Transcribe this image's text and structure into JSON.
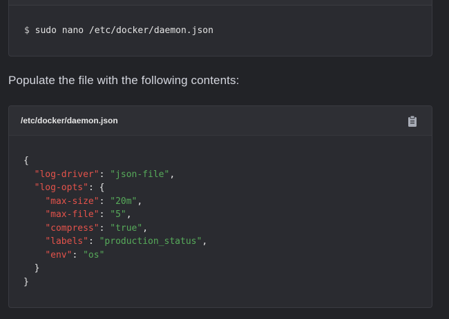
{
  "command_block": {
    "prompt": "$",
    "command": "sudo nano /etc/docker/daemon.json"
  },
  "instruction": "Populate the file with the following contents:",
  "code_block": {
    "filename": "/etc/docker/daemon.json",
    "copy_icon": "clipboard-icon",
    "lines": [
      [
        {
          "t": "{",
          "c": "p"
        }
      ],
      [
        {
          "t": "  ",
          "c": "p"
        },
        {
          "t": "\"log-driver\"",
          "c": "k"
        },
        {
          "t": ": ",
          "c": "p"
        },
        {
          "t": "\"json-file\"",
          "c": "s"
        },
        {
          "t": ",",
          "c": "p"
        }
      ],
      [
        {
          "t": "  ",
          "c": "p"
        },
        {
          "t": "\"log-opts\"",
          "c": "k"
        },
        {
          "t": ": {",
          "c": "p"
        }
      ],
      [
        {
          "t": "    ",
          "c": "p"
        },
        {
          "t": "\"max-size\"",
          "c": "k"
        },
        {
          "t": ": ",
          "c": "p"
        },
        {
          "t": "\"20m\"",
          "c": "s"
        },
        {
          "t": ",",
          "c": "p"
        }
      ],
      [
        {
          "t": "    ",
          "c": "p"
        },
        {
          "t": "\"max-file\"",
          "c": "k"
        },
        {
          "t": ": ",
          "c": "p"
        },
        {
          "t": "\"5\"",
          "c": "s"
        },
        {
          "t": ",",
          "c": "p"
        }
      ],
      [
        {
          "t": "    ",
          "c": "p"
        },
        {
          "t": "\"compress\"",
          "c": "k"
        },
        {
          "t": ": ",
          "c": "p"
        },
        {
          "t": "\"true\"",
          "c": "s"
        },
        {
          "t": ",",
          "c": "p"
        }
      ],
      [
        {
          "t": "    ",
          "c": "p"
        },
        {
          "t": "\"labels\"",
          "c": "k"
        },
        {
          "t": ": ",
          "c": "p"
        },
        {
          "t": "\"production_status\"",
          "c": "s"
        },
        {
          "t": ",",
          "c": "p"
        }
      ],
      [
        {
          "t": "    ",
          "c": "p"
        },
        {
          "t": "\"env\"",
          "c": "k"
        },
        {
          "t": ": ",
          "c": "p"
        },
        {
          "t": "\"os\"",
          "c": "s"
        }
      ],
      [
        {
          "t": "  }",
          "c": "p"
        }
      ],
      [
        {
          "t": "}",
          "c": "p"
        }
      ]
    ]
  },
  "colors": {
    "background": "#222327",
    "block_bg": "#2a2b30",
    "key": "#e5534b",
    "string": "#57ab5a",
    "punctuation": "#e4e4e4"
  }
}
